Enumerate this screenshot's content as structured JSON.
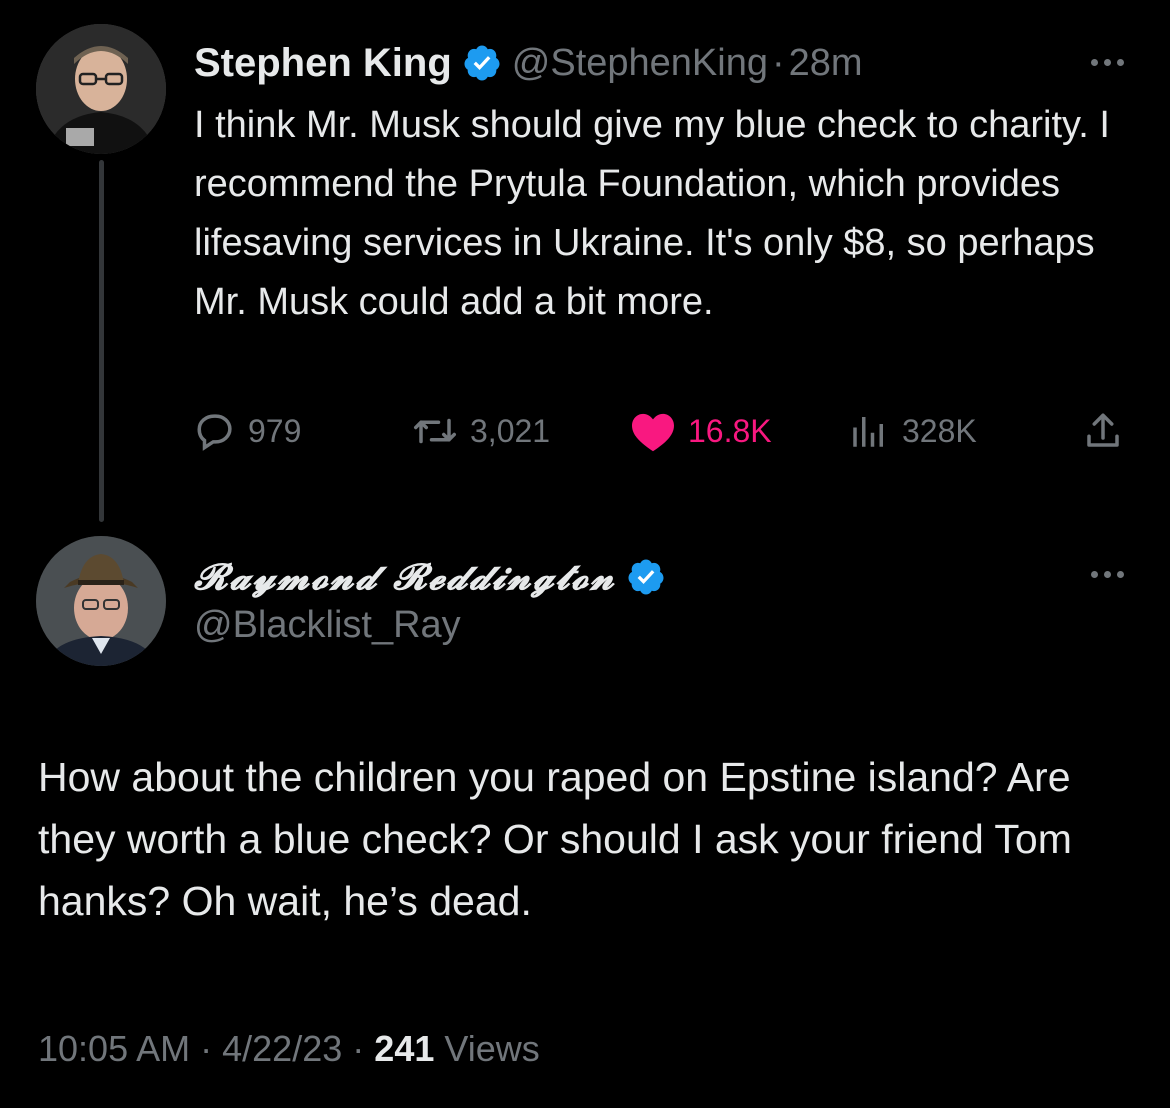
{
  "tweet1": {
    "display_name": "Stephen King",
    "handle": "@StephenKing",
    "separator": "·",
    "time": "28m",
    "text": "I think Mr. Musk should give my blue check to charity. I recommend the Prytula Foundation, which provides lifesaving services in Ukraine. It's only $8, so perhaps Mr. Musk could add a bit more.",
    "replies": "979",
    "retweets": "3,021",
    "likes": "16.8K",
    "views": "328K"
  },
  "tweet2": {
    "display_name": "𝓡𝓪𝔂𝓶𝓸𝓷𝓭 𝓡𝓮𝓭𝓭𝓲𝓷𝓰𝓽𝓸𝓷",
    "handle": "@Blacklist_Ray",
    "text": "How about the children you raped on Epstine island? Are they worth a blue check? Or should I ask your friend Tom hanks? Oh wait, he’s dead.",
    "time": "10:05 AM",
    "separator": "·",
    "date": "4/22/23",
    "views_count": "241",
    "views_label": "Views"
  },
  "colors": {
    "background": "#000000",
    "text": "#e7e9ea",
    "muted": "#71767b",
    "like": "#f91880",
    "verified": "#1d9bf0"
  },
  "icons": [
    "verified-badge-icon",
    "more-icon",
    "reply-icon",
    "retweet-icon",
    "heart-icon",
    "views-icon",
    "share-icon"
  ]
}
